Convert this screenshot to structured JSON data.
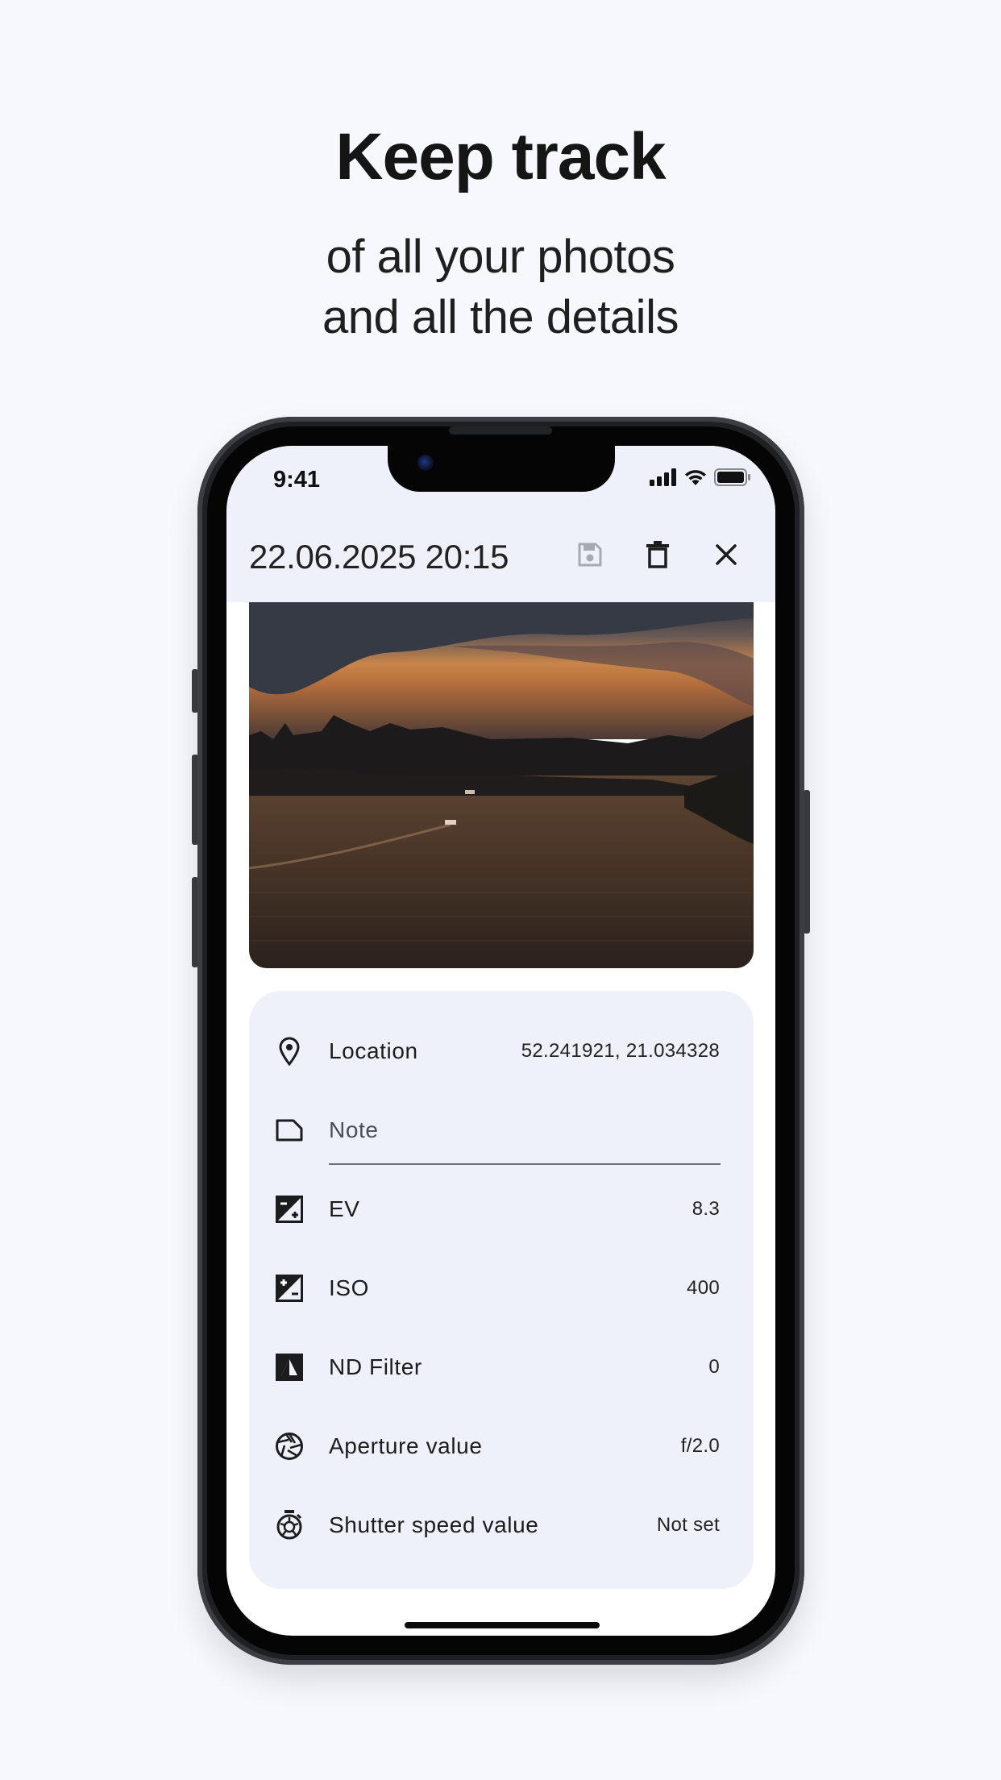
{
  "promo": {
    "headline": "Keep track",
    "subline_1": "of all your photos",
    "subline_2": "and all the details"
  },
  "status_bar": {
    "time": "9:41",
    "icons": [
      "cellular-signal-icon",
      "wifi-icon",
      "battery-icon"
    ]
  },
  "app_bar": {
    "title": "22.06.2025 20:15",
    "actions": [
      "save-icon",
      "trash-icon",
      "close-icon"
    ]
  },
  "photo": {
    "description_icon": "sunset-river-photo"
  },
  "details": {
    "rows": [
      {
        "icon": "location-pin-icon",
        "label": "Location",
        "value": "52.241921, 21.034328"
      },
      {
        "icon": "note-icon",
        "label": "Note",
        "value": ""
      },
      {
        "icon": "exposure-icon",
        "label": "EV",
        "value": "8.3"
      },
      {
        "icon": "iso-icon",
        "label": "ISO",
        "value": "400"
      },
      {
        "icon": "nd-filter-icon",
        "label": "ND Filter",
        "value": "0"
      },
      {
        "icon": "aperture-icon",
        "label": "Aperture value",
        "value": "f/2.0"
      },
      {
        "icon": "timer-icon",
        "label": "Shutter speed value",
        "value": "Not set"
      }
    ]
  },
  "colors": {
    "background": "#f6f8fe",
    "card": "#eef1fa",
    "appbar": "#eef1f9",
    "phone_frame": "#1f2024"
  }
}
